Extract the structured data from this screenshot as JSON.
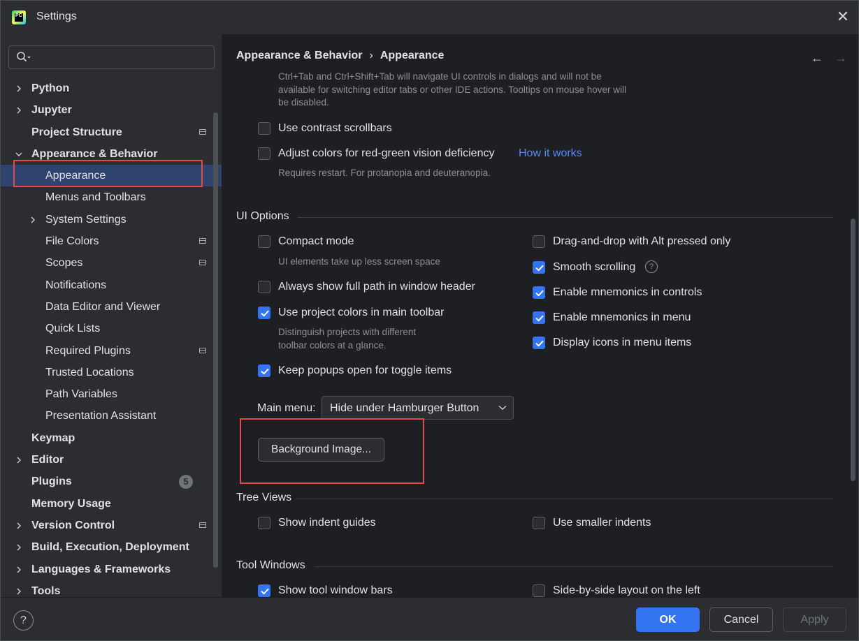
{
  "window": {
    "title": "Settings",
    "logo_text": "PC",
    "close_glyph": "✕"
  },
  "search": {
    "value": "",
    "placeholder": ""
  },
  "sidebar": {
    "items": [
      {
        "label": "Python",
        "level": 0,
        "bold": true,
        "chevron": "right"
      },
      {
        "label": "Jupyter",
        "level": 0,
        "bold": true,
        "chevron": "right"
      },
      {
        "label": "Project Structure",
        "level": 0,
        "bold": true,
        "project_icon": true
      },
      {
        "label": "Appearance & Behavior",
        "level": 0,
        "bold": true,
        "chevron": "down"
      },
      {
        "label": "Appearance",
        "level": 1,
        "selected": true
      },
      {
        "label": "Menus and Toolbars",
        "level": 1
      },
      {
        "label": "System Settings",
        "level": 1,
        "chevron": "right"
      },
      {
        "label": "File Colors",
        "level": 1,
        "project_icon": true
      },
      {
        "label": "Scopes",
        "level": 1,
        "project_icon": true
      },
      {
        "label": "Notifications",
        "level": 1
      },
      {
        "label": "Data Editor and Viewer",
        "level": 1
      },
      {
        "label": "Quick Lists",
        "level": 1
      },
      {
        "label": "Required Plugins",
        "level": 1,
        "project_icon": true
      },
      {
        "label": "Trusted Locations",
        "level": 1
      },
      {
        "label": "Path Variables",
        "level": 1
      },
      {
        "label": "Presentation Assistant",
        "level": 1
      },
      {
        "label": "Keymap",
        "level": 0,
        "bold": true
      },
      {
        "label": "Editor",
        "level": 0,
        "bold": true,
        "chevron": "right"
      },
      {
        "label": "Plugins",
        "level": 0,
        "bold": true,
        "badge": "5"
      },
      {
        "label": "Memory Usage",
        "level": 0,
        "bold": true
      },
      {
        "label": "Version Control",
        "level": 0,
        "bold": true,
        "chevron": "right",
        "project_icon": true
      },
      {
        "label": "Build, Execution, Deployment",
        "level": 0,
        "bold": true,
        "chevron": "right"
      },
      {
        "label": "Languages & Frameworks",
        "level": 0,
        "bold": true,
        "chevron": "right"
      },
      {
        "label": "Tools",
        "level": 0,
        "bold": true,
        "chevron": "right"
      }
    ]
  },
  "breadcrumb": {
    "parent": "Appearance & Behavior",
    "separator": "›",
    "current": "Appearance",
    "back_glyph": "←",
    "forward_glyph": "→"
  },
  "accessibility": {
    "truncated_hint_line1": "Ctrl+Tab and Ctrl+Shift+Tab will navigate UI controls in dialogs and will not be",
    "truncated_hint_line2": "available for switching editor tabs or other IDE actions. Tooltips on mouse hover will",
    "truncated_hint_line3": "be disabled.",
    "contrast_scrollbars": {
      "label": "Use contrast scrollbars",
      "checked": false
    },
    "color_deficiency": {
      "label": "Adjust colors for red-green vision deficiency",
      "checked": false,
      "link": "How it works",
      "hint": "Requires restart. For protanopia and deuteranopia."
    }
  },
  "ui_options": {
    "title": "UI Options",
    "compact_mode": {
      "label": "Compact mode",
      "checked": false,
      "hint": "UI elements take up less screen space"
    },
    "full_path": {
      "label": "Always show full path in window header",
      "checked": false
    },
    "project_colors": {
      "label": "Use project colors in main toolbar",
      "checked": true,
      "hint_line1": "Distinguish projects with different",
      "hint_line2": "toolbar colors at a glance."
    },
    "keep_popups": {
      "label": "Keep popups open for toggle items",
      "checked": true
    },
    "drag_drop_alt": {
      "label": "Drag-and-drop with Alt pressed only",
      "checked": false
    },
    "smooth_scrolling": {
      "label": "Smooth scrolling",
      "checked": true,
      "help_glyph": "?"
    },
    "mnemonics_controls": {
      "label": "Enable mnemonics in controls",
      "checked": true
    },
    "mnemonics_menu": {
      "label": "Enable mnemonics in menu",
      "checked": true
    },
    "menu_icons": {
      "label": "Display icons in menu items",
      "checked": true
    },
    "main_menu_label": "Main menu:",
    "main_menu_value": "Hide under Hamburger Button",
    "background_image_button": "Background Image..."
  },
  "tree_views": {
    "title": "Tree Views",
    "indent_guides": {
      "label": "Show indent guides",
      "checked": false
    },
    "smaller_indents": {
      "label": "Use smaller indents",
      "checked": false
    }
  },
  "tool_windows": {
    "title": "Tool Windows",
    "tool_window_bars": {
      "label": "Show tool window bars",
      "checked": true
    },
    "side_by_side": {
      "label": "Side-by-side layout on the left",
      "checked": false
    }
  },
  "footer": {
    "help_glyph": "?",
    "ok": "OK",
    "cancel": "Cancel",
    "apply": "Apply"
  },
  "colors": {
    "accent": "#3574f0",
    "highlight_box": "#e5484d",
    "selection": "#2e436e",
    "link": "#548af7"
  },
  "icons": {
    "search": "search-icon",
    "close": "close-icon",
    "chevron_right": "chevron-right-icon",
    "chevron_down": "chevron-down-icon",
    "project_scope": "project-scope-icon",
    "checkmark": "checkmark-icon"
  }
}
